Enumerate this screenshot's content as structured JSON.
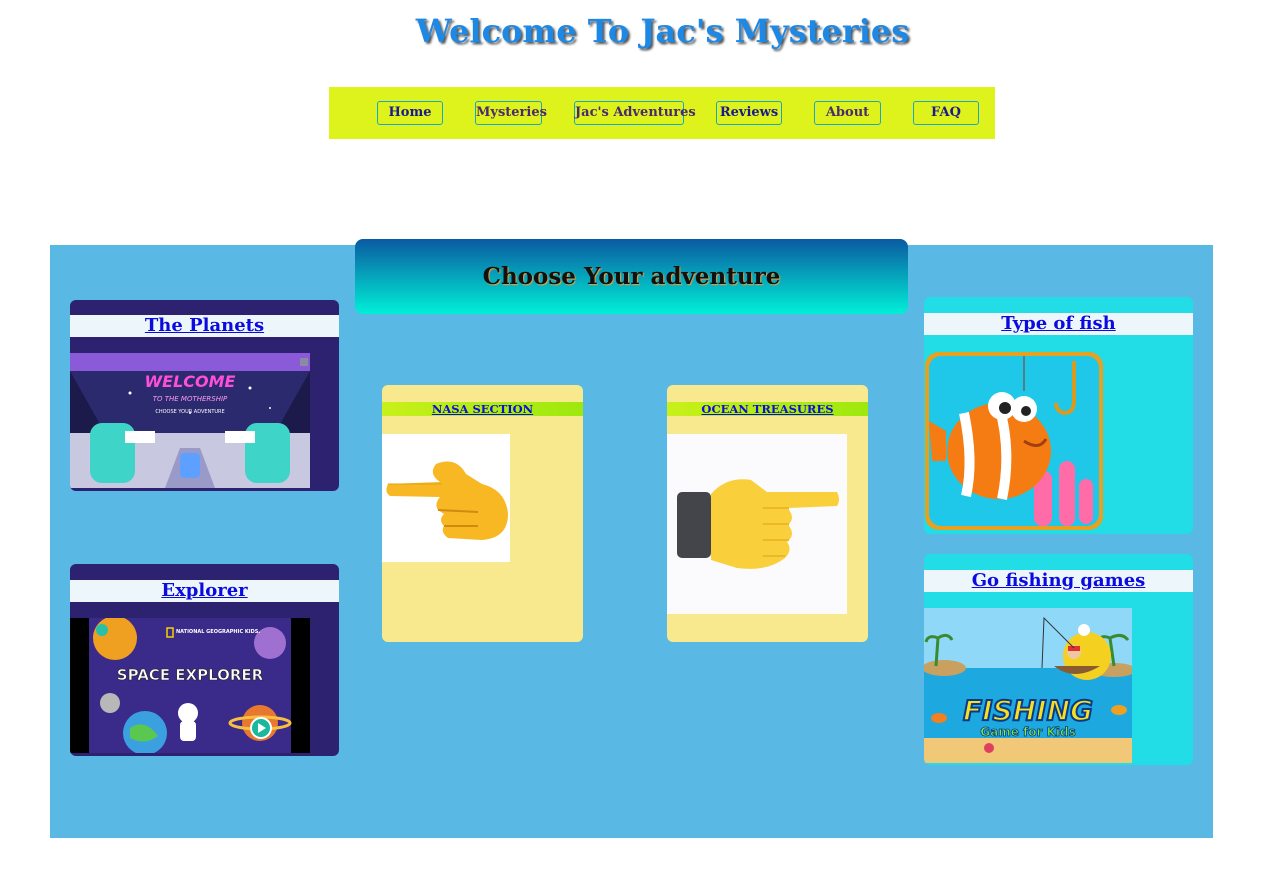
{
  "header": {
    "title": "Welcome To Jac's Mysteries"
  },
  "nav": {
    "items": [
      {
        "label": "Home"
      },
      {
        "label": "Mysteries"
      },
      {
        "label": "Jac's Adventures"
      },
      {
        "label": "Reviews"
      },
      {
        "label": "About"
      },
      {
        "label": "FAQ"
      }
    ]
  },
  "banner": {
    "title": "Choose Your adventure"
  },
  "left_cards": [
    {
      "title": "The Planets",
      "image_text": [
        "WELCOME",
        "TO THE MOTHERSHIP",
        "CHOOSE YOUR ADVENTURE"
      ]
    },
    {
      "title": "Explorer",
      "image_text": [
        "NATIONAL GEOGRAPHIC KIDS.",
        "SPACE EXPLORER"
      ]
    }
  ],
  "center_cards": [
    {
      "title": "NASA SECTION",
      "icon": "pointing-right-hand-icon"
    },
    {
      "title": "OCEAN TREASURES",
      "icon": "pointing-right-hand-icon"
    }
  ],
  "right_cards": [
    {
      "title": "Type of fish",
      "icon": "cartoon-fish-icon"
    },
    {
      "title": "Go fishing games",
      "image_text": [
        "FISHING",
        "Game for Kids"
      ]
    }
  ],
  "colors": {
    "nav_background": "#def21c",
    "main_background": "#5ab8e4",
    "dark_card": "#2d2270",
    "cyan_card": "#22dde6",
    "yellow_card": "#f8e98e",
    "title": "#1e88e5"
  }
}
